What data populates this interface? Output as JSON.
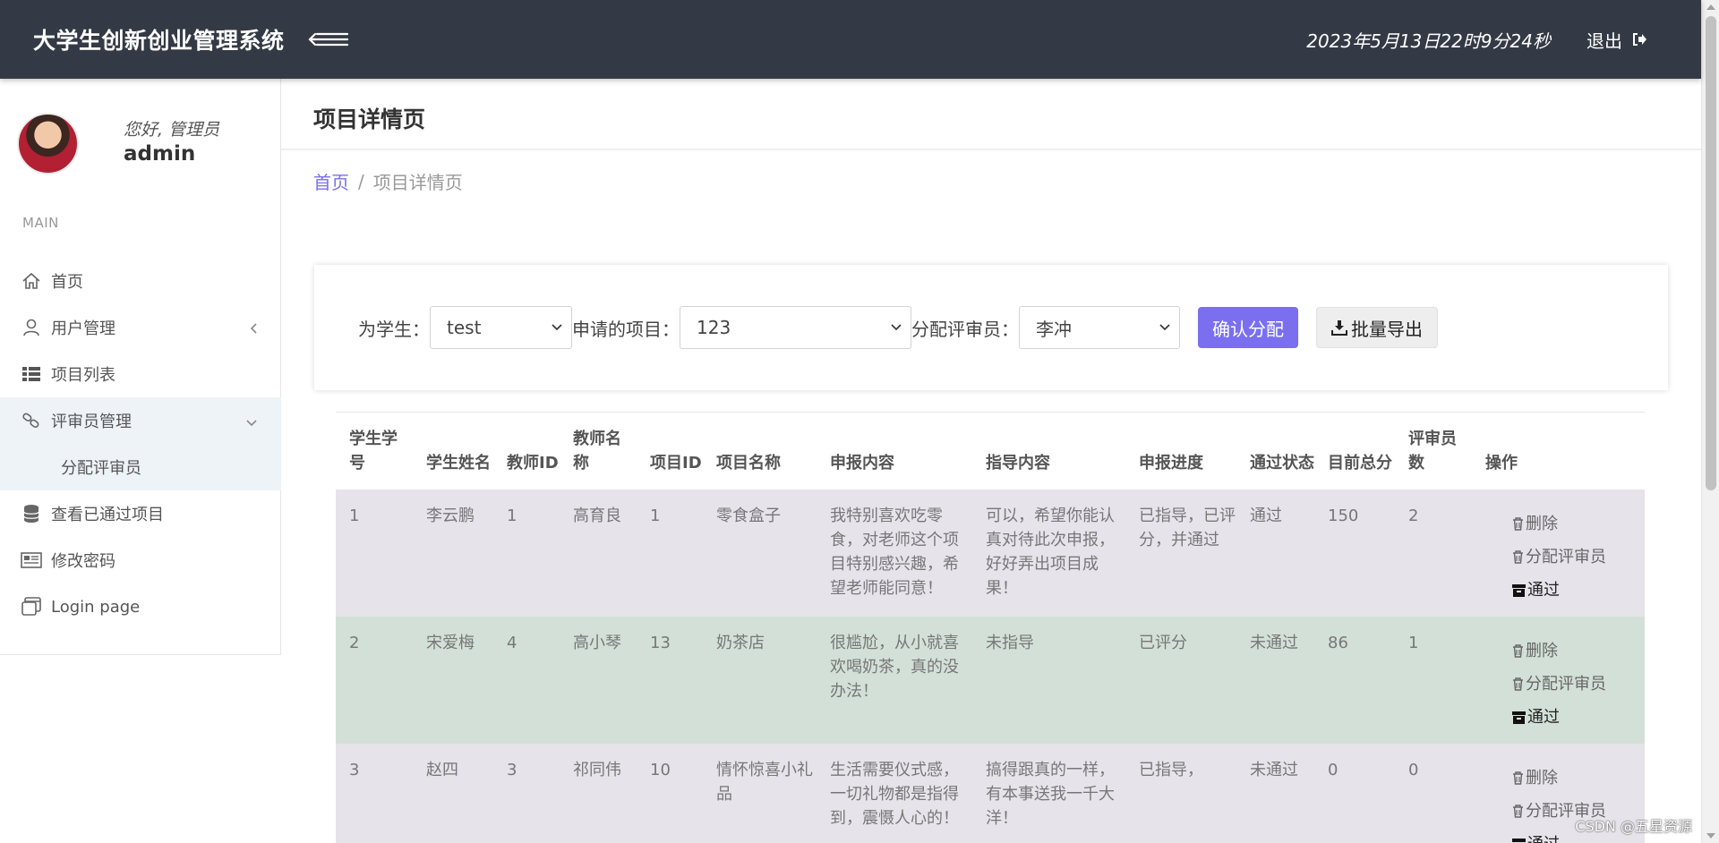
{
  "header": {
    "brand": "大学生创新创业管理系统",
    "datetime": "2023年5月13日22时9分24秒",
    "logout_label": "退出"
  },
  "sidebar": {
    "greeting": "您好, 管理员",
    "username": "admin",
    "section_label": "MAIN",
    "items": [
      {
        "label": "首页",
        "icon": "home-icon"
      },
      {
        "label": "用户管理",
        "icon": "user-icon"
      },
      {
        "label": "项目列表",
        "icon": "list-icon"
      },
      {
        "label": "评审员管理",
        "icon": "link-icon"
      },
      {
        "label": "分配评审员"
      },
      {
        "label": "查看已通过项目",
        "icon": "database-icon"
      },
      {
        "label": "修改密码",
        "icon": "newspaper-icon"
      },
      {
        "label": "Login page",
        "icon": "window-icon"
      }
    ]
  },
  "page": {
    "title": "项目详情页",
    "breadcrumb_home": "首页",
    "breadcrumb_sep": "/",
    "breadcrumb_current": "项目详情页"
  },
  "form": {
    "student_label": "为学生：",
    "student_value": "test",
    "project_label": "申请的项目：",
    "project_value": "123",
    "reviewer_label": "分配评审员：",
    "reviewer_value": "李冲",
    "confirm_label": "确认分配",
    "export_label": "批量导出"
  },
  "table": {
    "headers": [
      "学生学号",
      "学生姓名",
      "教师ID",
      "教师名称",
      "项目ID",
      "项目名称",
      "申报内容",
      "指导内容",
      "申报进度",
      "通过状态",
      "目前总分",
      "评审员数",
      "操作"
    ],
    "rows": [
      {
        "sid": "1",
        "sname": "李云鹏",
        "tid": "1",
        "tname": "高育良",
        "pid": "1",
        "pname": "零食盒子",
        "content": "我特别喜欢吃零食，对老师这个项目特别感兴趣，希望老师能同意！",
        "guide": "可以，希望你能认真对待此次申报，好好弄出项目成果！",
        "progress": "已指导，已评分，并通过",
        "status": "通过",
        "score": "150",
        "reviewers": "2"
      },
      {
        "sid": "2",
        "sname": "宋爱梅",
        "tid": "4",
        "tname": "高小琴",
        "pid": "13",
        "pname": "奶茶店",
        "content": "很尴尬，从小就喜欢喝奶茶，真的没办法！",
        "guide": "未指导",
        "progress": "已评分",
        "status": "未通过",
        "score": "86",
        "reviewers": "1"
      },
      {
        "sid": "3",
        "sname": "赵四",
        "tid": "3",
        "tname": "祁同伟",
        "pid": "10",
        "pname": "情怀惊喜小礼品",
        "content": "生活需要仪式感，一切礼物都是指得到，震慑人心的！",
        "guide": "搞得跟真的一样，有本事送我一千大洋！",
        "progress": "已指导，",
        "status": "未通过",
        "score": "0",
        "reviewers": "0"
      }
    ],
    "ops": {
      "delete": "删除",
      "assign": "分配评审员",
      "pass": "通过"
    }
  },
  "watermark": "CSDN @五星资源",
  "colors": {
    "topbar": "#343a45",
    "accent": "#7b6ff0",
    "row_odd": "#e7e3ea",
    "row_even": "#d3e0d7"
  }
}
